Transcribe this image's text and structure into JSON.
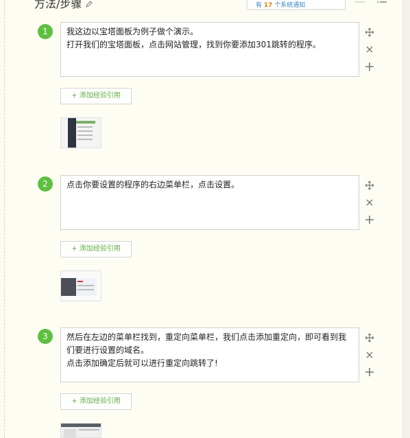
{
  "header": {
    "title": "方法/步骤",
    "notice_prefix": "有",
    "notice_count": "17",
    "notice_suffix": "个系统通知"
  },
  "steps": [
    {
      "number": "1",
      "lines": [
        "我这边以宝塔面板为例子做个演示。",
        "打开我们的宝塔面板，点击网站管理，找到你要添加301跳转的程序。"
      ],
      "quote_label": "+ 添加经验引用"
    },
    {
      "number": "2",
      "lines": [
        "点击你要设置的程序的右边菜单栏，点击设置。"
      ],
      "quote_label": "+ 添加经验引用"
    },
    {
      "number": "3",
      "lines": [
        "然后在左边的菜单栏找到，重定向菜单栏，我们点击添加重定向，即可看到我们要进行设置的域名。",
        "点击添加确定后就可以进行重定向跳转了!"
      ],
      "quote_label": "+ 添加经验引用"
    }
  ],
  "colors": {
    "accent_green": "#5fbf3f",
    "notice_blue": "#3a86c8",
    "notice_orange": "#f08300"
  },
  "icons": [
    "edit-icon",
    "move-icon",
    "close-icon",
    "add-icon",
    "list-icon"
  ]
}
